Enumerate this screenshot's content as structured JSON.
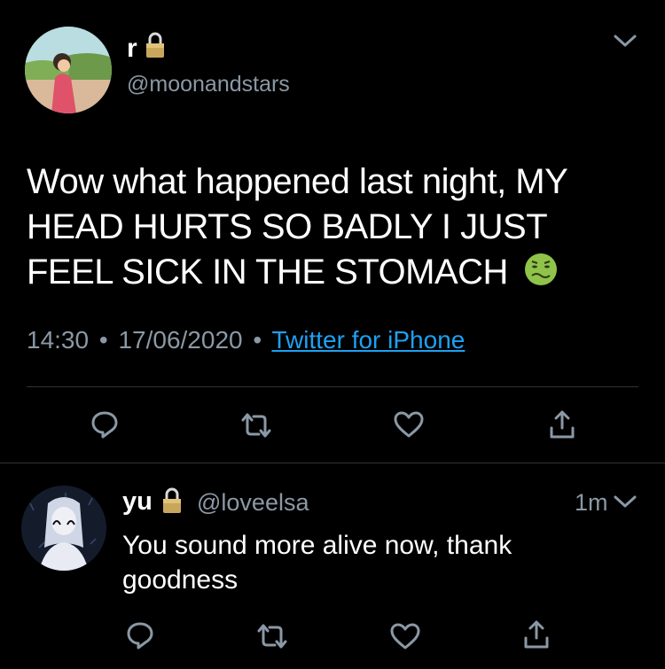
{
  "tweet": {
    "display_name": "r",
    "handle": "@moonandstars",
    "text": "Wow what happened last night, MY HEAD HURTS SO BADLY I JUST FEEL SICK IN THE STOMACH",
    "emoji": "🤢",
    "time": "14:30",
    "separator": "•",
    "date": "17/06/2020",
    "source": "Twitter for iPhone"
  },
  "reply": {
    "display_name": "yu",
    "handle": "@loveelsa",
    "age": "1m",
    "text_line1": "You sound more alive now, thank",
    "text_line2": "goodness"
  },
  "colors": {
    "background": "#000000",
    "muted": "#8b98a5",
    "link": "#1da1f2",
    "divider": "#2f3336"
  }
}
